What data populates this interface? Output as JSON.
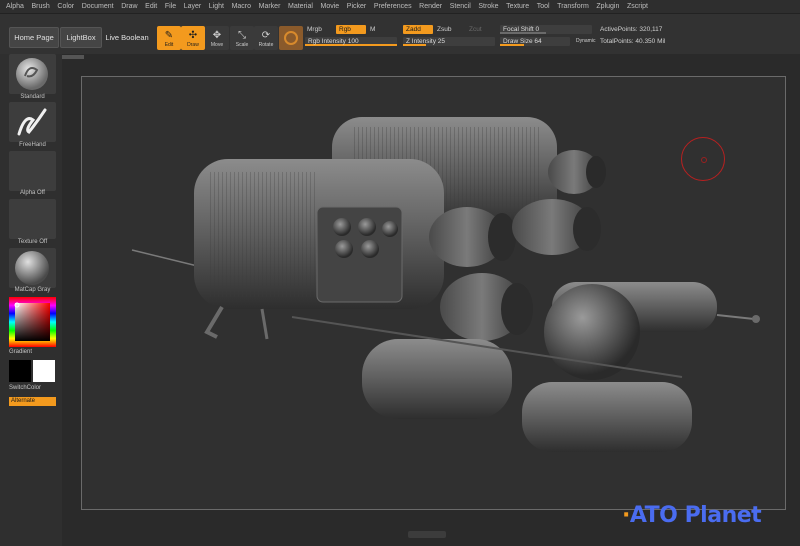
{
  "menu": [
    "Alpha",
    "Brush",
    "Color",
    "Document",
    "Draw",
    "Edit",
    "File",
    "Layer",
    "Light",
    "Macro",
    "Marker",
    "Material",
    "Movie",
    "Picker",
    "Preferences",
    "Render",
    "Stencil",
    "Stroke",
    "Texture",
    "Tool",
    "Transform",
    "Zplugin",
    "Zscript"
  ],
  "shelf": {
    "home_page": "Home Page",
    "lightbox": "LightBox",
    "live_boolean": "Live Boolean",
    "tools": [
      {
        "label": "Edit",
        "icon": "edit-icon",
        "active": true
      },
      {
        "label": "Draw",
        "icon": "draw-icon",
        "active": true
      },
      {
        "label": "Move",
        "icon": "move-icon",
        "active": false
      },
      {
        "label": "Scale",
        "icon": "scale-icon",
        "active": false
      },
      {
        "label": "Rotate",
        "icon": "rotate-icon",
        "active": false
      }
    ],
    "mrgb": "Mrgb",
    "rgb": "Rgb",
    "m": "M",
    "zadd": "Zadd",
    "zsub": "Zsub",
    "zcut": "Zcut",
    "rgb_intensity": "Rgb Intensity 100",
    "z_intensity": "Z Intensity 25",
    "focal_shift": "Focal Shift 0",
    "draw_size": "Draw Size 64",
    "dynamic": "Dynamic",
    "active_points": "ActivePoints: 320,117",
    "total_points": "TotalPoints: 40.350 Mil"
  },
  "tray": {
    "brush": "Standard",
    "stroke": "FreeHand",
    "alpha": "Alpha Off",
    "texture": "Texture Off",
    "material": "MatCap Gray",
    "gradient": "Gradient",
    "switch_color": "SwitchColor",
    "alternate": "Alternate"
  },
  "colors": {
    "accent": "#f39a1e",
    "background": "#2a2a2a",
    "panel": "#323232"
  },
  "watermark": {
    "prefix": "ATO",
    "suffix": "Planet"
  }
}
